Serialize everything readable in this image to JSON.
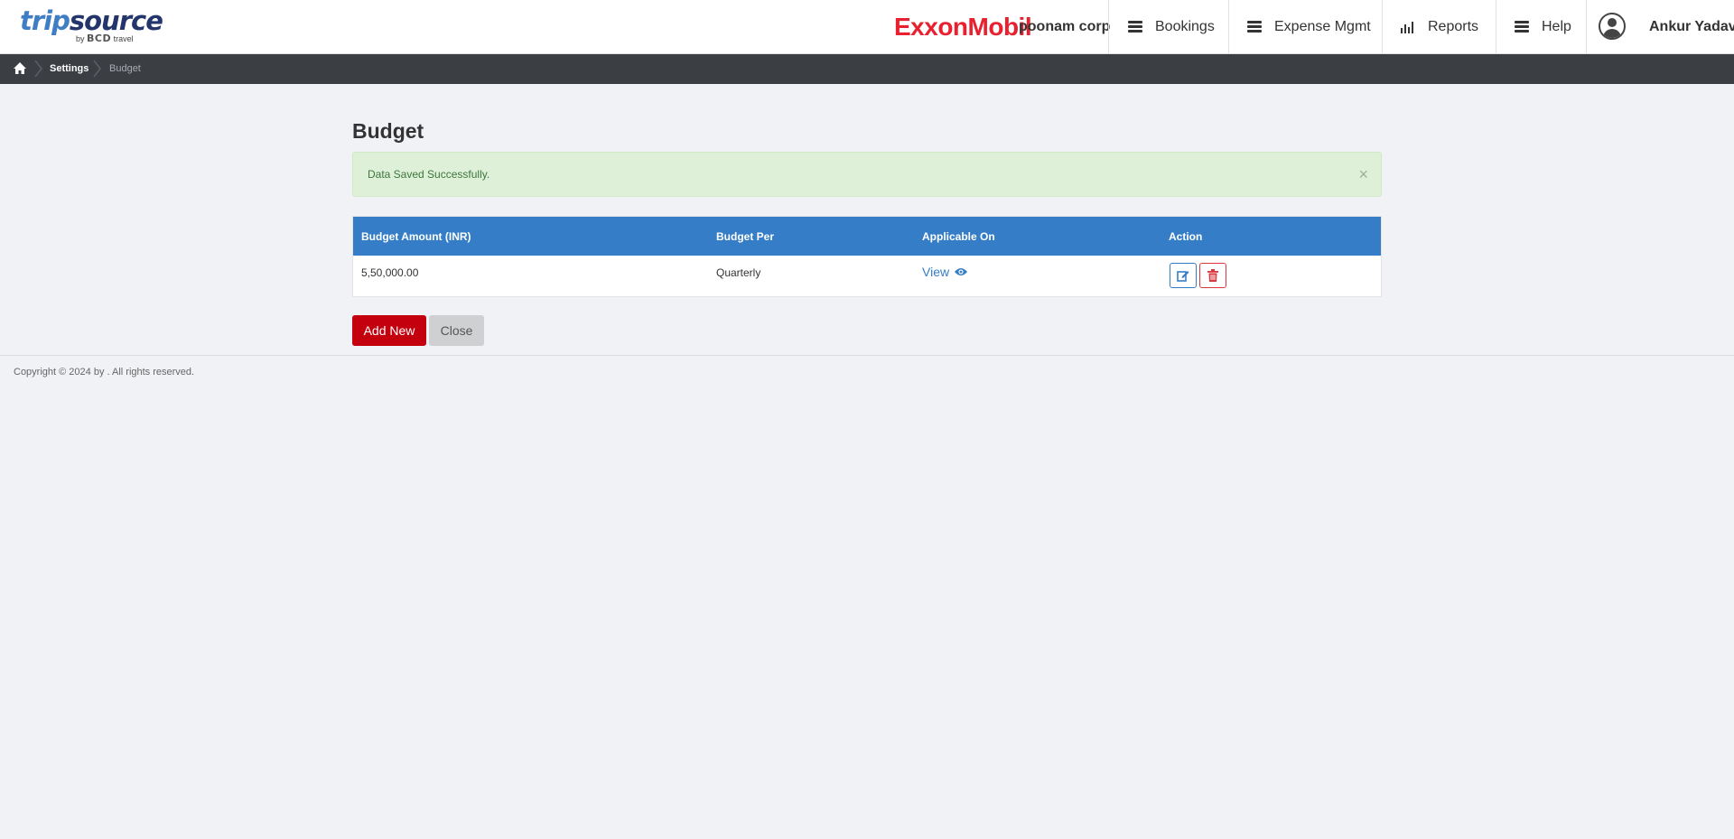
{
  "header": {
    "logo": {
      "brand_part1": "trip",
      "brand_part2": "source",
      "by_prefix": "by",
      "by_brand": "BCD",
      "by_suffix": "travel"
    },
    "corp_logo": "ExxonMobil",
    "corp_name": "poonam corp",
    "nav": [
      {
        "label": "Bookings",
        "icon": "menu-icon"
      },
      {
        "label": "Expense Mgmt",
        "icon": "menu-icon"
      },
      {
        "label": "Reports",
        "icon": "bar-chart-icon"
      },
      {
        "label": "Help",
        "icon": "menu-icon"
      }
    ],
    "user": {
      "name": "Ankur Yadav",
      "icon": "user-avatar-icon"
    }
  },
  "breadcrumb": {
    "home_icon": "home-icon",
    "items": [
      {
        "label": "Settings"
      },
      {
        "label": "Budget"
      }
    ]
  },
  "main": {
    "title": "Budget",
    "alert": {
      "message": "Data Saved Successfully.",
      "close": "×"
    },
    "table": {
      "columns": [
        "Budget Amount (INR)",
        "Budget Per",
        "Applicable On",
        "Action"
      ],
      "rows": [
        {
          "amount": "5,50,000.00",
          "per": "Quarterly",
          "applicable_on": "View",
          "actions": [
            "edit-icon",
            "trash-icon"
          ]
        }
      ]
    },
    "buttons": {
      "add_new": "Add New",
      "close": "Close"
    }
  },
  "footer": {
    "copyright": "Copyright © 2024 by . All rights reserved."
  },
  "colors": {
    "header_blue": "#357ec7",
    "add_red": "#c4000e",
    "alert_bg": "#dff0d8",
    "breadcrumb_bg": "#3b3f44",
    "brand_red": "#e8202f"
  }
}
